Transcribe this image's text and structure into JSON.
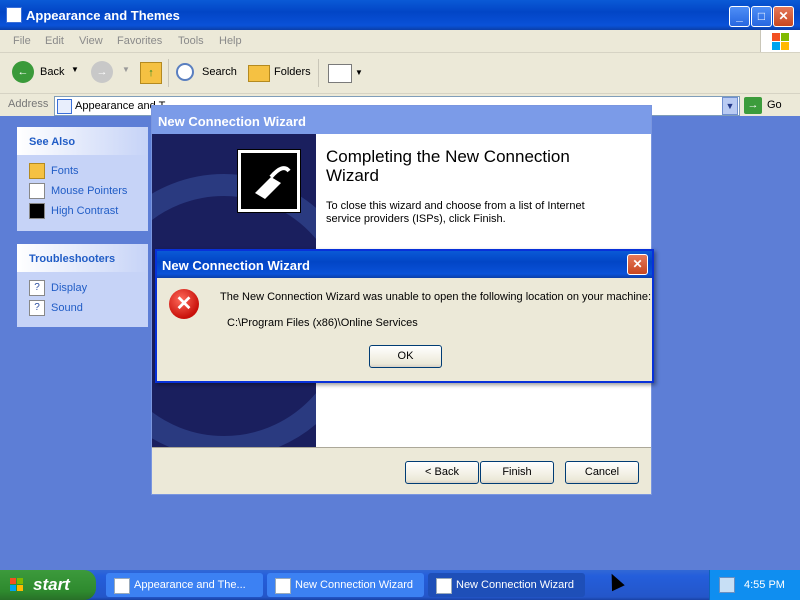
{
  "explorer": {
    "title": "Appearance and Themes",
    "menu": [
      "File",
      "Edit",
      "View",
      "Favorites",
      "Tools",
      "Help"
    ],
    "toolbar": {
      "back": "Back",
      "search": "Search",
      "folders": "Folders"
    },
    "address": {
      "label": "Address",
      "value": "Appearance and T",
      "go": "Go"
    }
  },
  "see_also": {
    "heading": "See Also",
    "items": [
      {
        "label": "Fonts",
        "icon": "folder-icon"
      },
      {
        "label": "Mouse Pointers",
        "icon": "mouse-icon"
      },
      {
        "label": "High Contrast",
        "icon": "contrast-icon"
      }
    ]
  },
  "troubleshooters": {
    "heading": "Troubleshooters",
    "items": [
      {
        "label": "Display",
        "icon": "help-icon"
      },
      {
        "label": "Sound",
        "icon": "help-icon"
      }
    ]
  },
  "wizard": {
    "title": "New Connection Wizard",
    "heading": "Completing the New Connection Wizard",
    "description": "To close this wizard and choose from a list of Internet service providers (ISPs), click Finish.",
    "back": "< Back",
    "finish": "Finish",
    "cancel": "Cancel"
  },
  "error": {
    "title": "New Connection Wizard",
    "message": "The New Connection Wizard was unable to open the following location on your machine:",
    "path": "C:\\Program Files (x86)\\Online Services",
    "ok": "OK"
  },
  "taskbar": {
    "start": "start",
    "tasks": [
      {
        "label": "Appearance and The..."
      },
      {
        "label": "New Connection Wizard"
      },
      {
        "label": "New Connection Wizard"
      }
    ],
    "clock": "4:55 PM"
  }
}
